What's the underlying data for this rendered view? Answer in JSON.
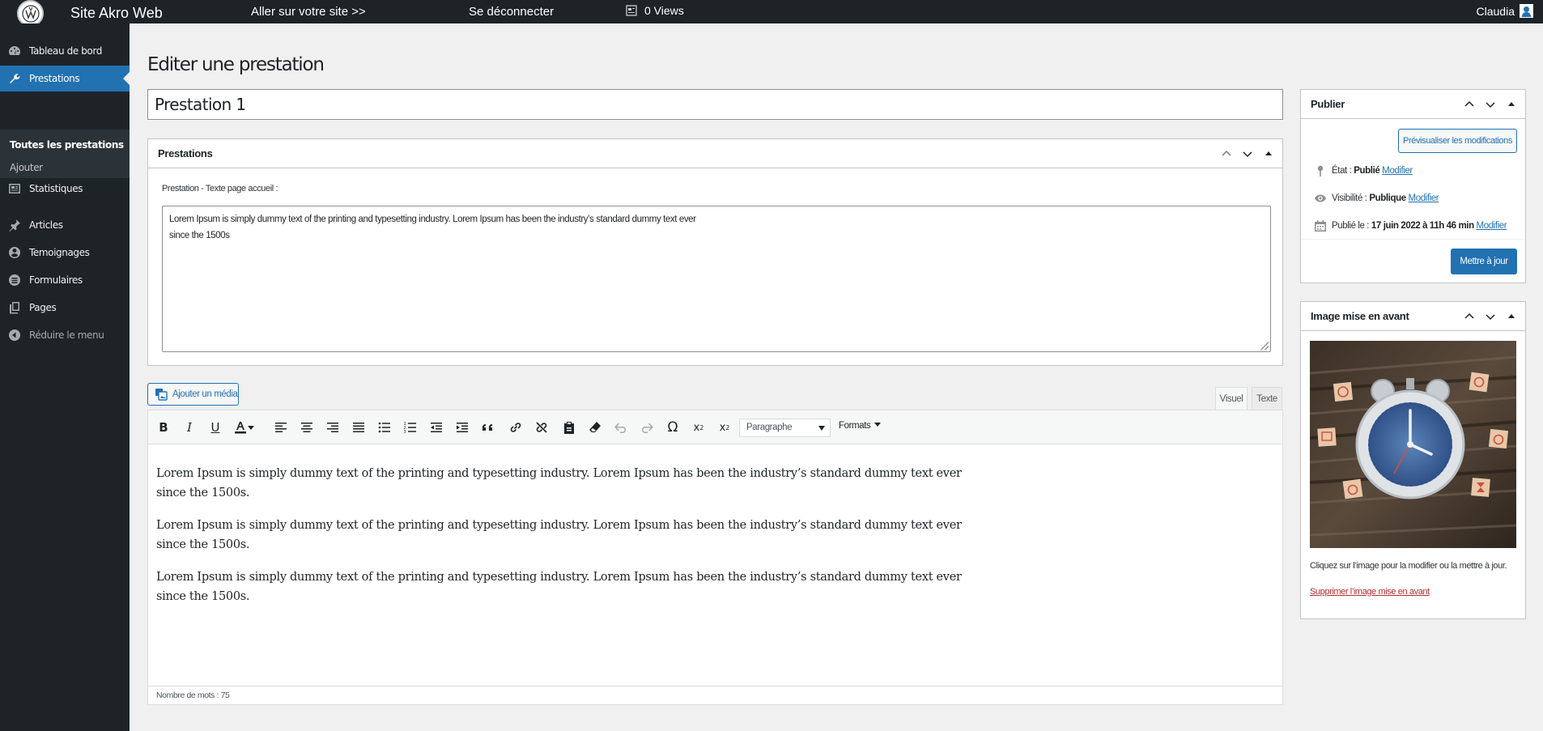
{
  "topbar": {
    "site_name": "Site Akro Web",
    "visit_site": "Aller sur votre site >>",
    "logout": "Se déconnecter",
    "views": "0 Views",
    "user": "Claudia"
  },
  "sidebar": {
    "items": [
      {
        "label": "Tableau de bord",
        "icon": "dashboard-icon"
      },
      {
        "label": "Prestations",
        "icon": "wrench-icon"
      },
      {
        "label": "Statistiques",
        "icon": "stats-icon"
      },
      {
        "label": "Articles",
        "icon": "pin-icon"
      },
      {
        "label": "Temoignages",
        "icon": "testimonial-icon"
      },
      {
        "label": "Formulaires",
        "icon": "forms-icon"
      },
      {
        "label": "Pages",
        "icon": "pages-icon"
      },
      {
        "label": "Réduire le menu",
        "icon": "collapse-icon"
      }
    ],
    "submenu": {
      "current": "Toutes les prestations",
      "add": "Ajouter"
    }
  },
  "main": {
    "page_title": "Editer une prestation",
    "post_title": "Prestation 1",
    "prestations_box": {
      "title": "Prestations",
      "field_label": "Prestation - Texte page accueil :",
      "field_value_line1": "Lorem Ipsum is simply dummy text of the printing and typesetting industry. Lorem Ipsum has been the industry’s standard dummy text ever",
      "field_value_line2": "since the 1500s"
    },
    "add_media": "Ajouter un média",
    "tabs": {
      "visual": "Visuel",
      "text": "Texte"
    },
    "toolbar": {
      "paragraph": "Paragraphe",
      "formats": "Formats"
    },
    "content": [
      "Lorem Ipsum is simply dummy text of the printing and typesetting industry. Lorem Ipsum has been the industry’s standard dummy text ever since the 1500s.",
      "Lorem Ipsum is simply dummy text of the printing and typesetting industry. Lorem Ipsum has been the industry’s standard dummy text ever since the 1500s.",
      "Lorem Ipsum is simply dummy text of the printing and typesetting industry. Lorem Ipsum has been the industry’s standard dummy text ever since the 1500s."
    ],
    "word_count": "Nombre de mots : 75"
  },
  "publish": {
    "title": "Publier",
    "preview": "Prévisualiser les modifications",
    "status_label": "État : ",
    "status_value": "Publié",
    "visibility_label": "Visibilité : ",
    "visibility_value": "Publique",
    "published_label": "Publié le : ",
    "published_value": "17 juin 2022 à 11h 46 min",
    "modify": "Modifier",
    "update": "Mettre à jour"
  },
  "featured_image": {
    "title": "Image mise en avant",
    "hint": "Cliquez sur l’image pour la modifier ou la mettre à jour.",
    "remove": "Supprimer l’image mise en avant"
  },
  "colors": {
    "admin_dark": "#1d2327",
    "accent": "#2271b1",
    "danger": "#b32d2e"
  }
}
